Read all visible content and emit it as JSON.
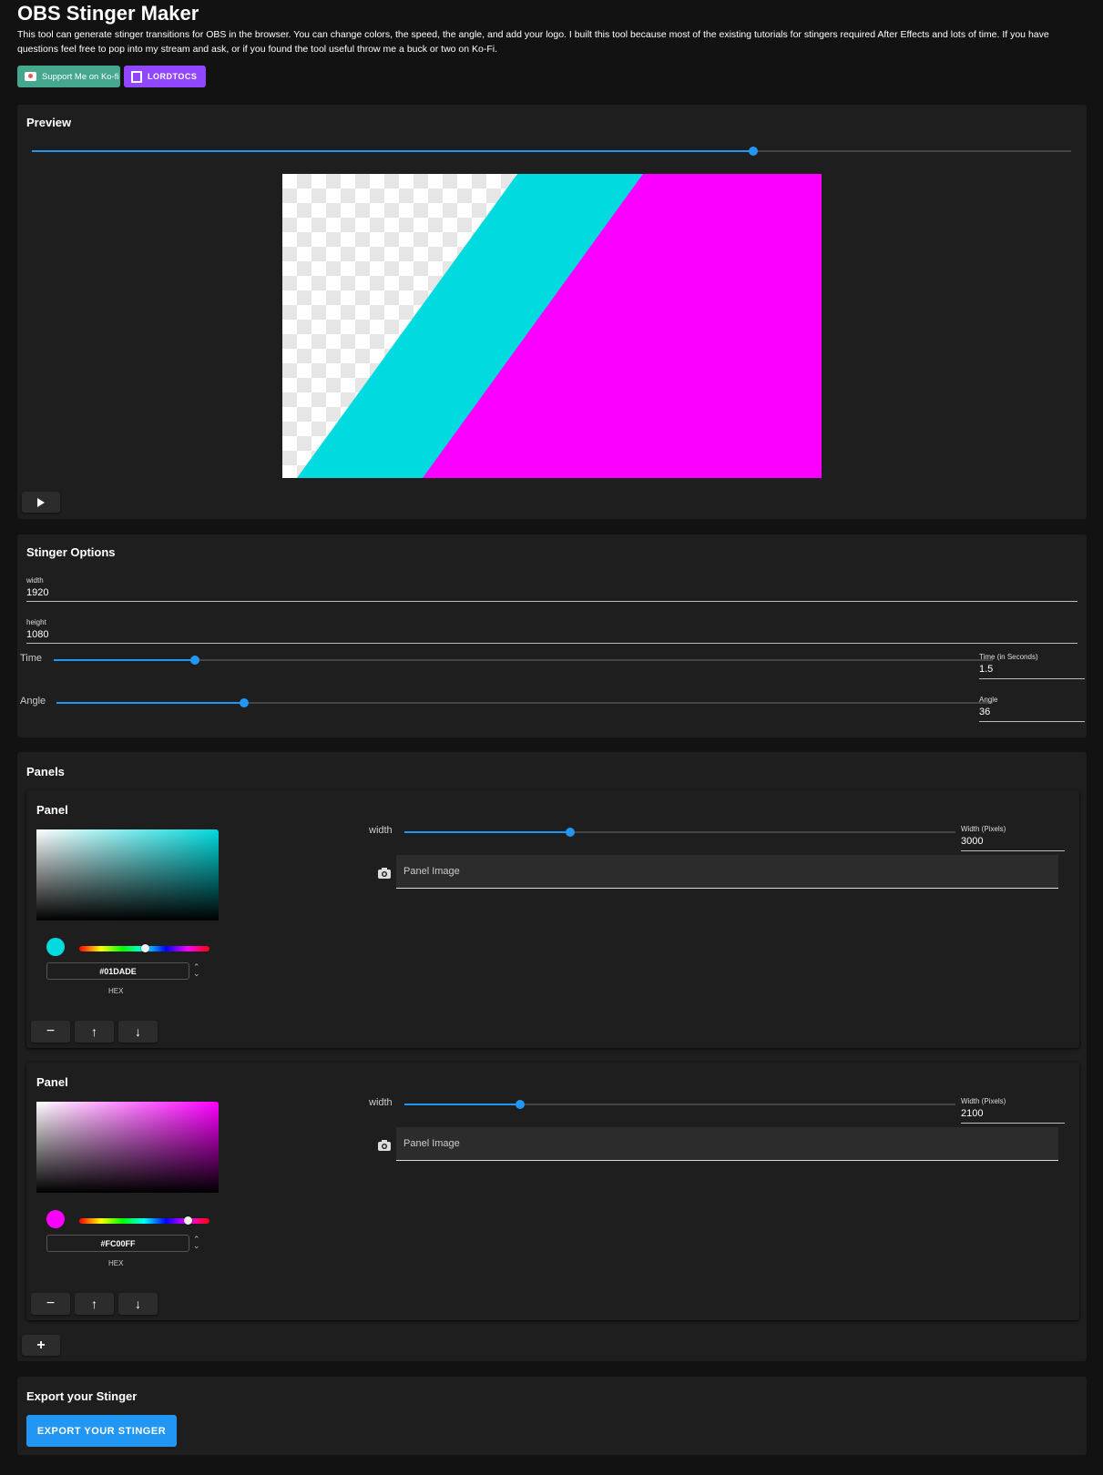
{
  "header": {
    "title": "OBS Stinger Maker",
    "description": "This tool can generate stinger transitions for OBS in the browser. You can change colors, the speed, the angle, and add your logo. I built this tool because most of the existing tutorials for stingers required After Effects and lots of time. If you have questions feel free to pop into my stream and ask, or if you found the tool useful throw me a buck or two on Ko-Fi.",
    "kofi_label": "Support Me on Ko-fi",
    "twitch_label": "LORDTOCS"
  },
  "preview": {
    "title": "Preview",
    "scrub_fraction": 0.694,
    "play_icon": "play-icon"
  },
  "options": {
    "title": "Stinger Options",
    "width_label": "width",
    "width_value": "1920",
    "height_label": "height",
    "height_value": "1080",
    "time_label": "Time",
    "time_field_label": "Time (in Seconds)",
    "time_value": "1.5",
    "time_fraction": 0.15,
    "angle_label": "Angle",
    "angle_field_label": "Angle",
    "angle_value": "36",
    "angle_fraction": 0.2
  },
  "panels": {
    "title": "Panels",
    "items": [
      {
        "title": "Panel",
        "color": "#01DADE",
        "hex": "#01DADE",
        "hex_label": "HEX",
        "hue_fraction": 0.5,
        "width_label": "width",
        "width_field_label": "Width (Pixels)",
        "width_value": "3000",
        "width_fraction": 0.3,
        "image_label": "Panel Image"
      },
      {
        "title": "Panel",
        "color": "#FC00FF",
        "hex": "#FC00FF",
        "hex_label": "HEX",
        "hue_fraction": 0.83,
        "width_label": "width",
        "width_field_label": "Width (Pixels)",
        "width_value": "2100",
        "width_fraction": 0.21,
        "image_label": "Panel Image"
      }
    ],
    "add_icon": "plus-icon"
  },
  "export": {
    "title": "Export your Stinger",
    "button_label": "EXPORT YOUR STINGER"
  }
}
